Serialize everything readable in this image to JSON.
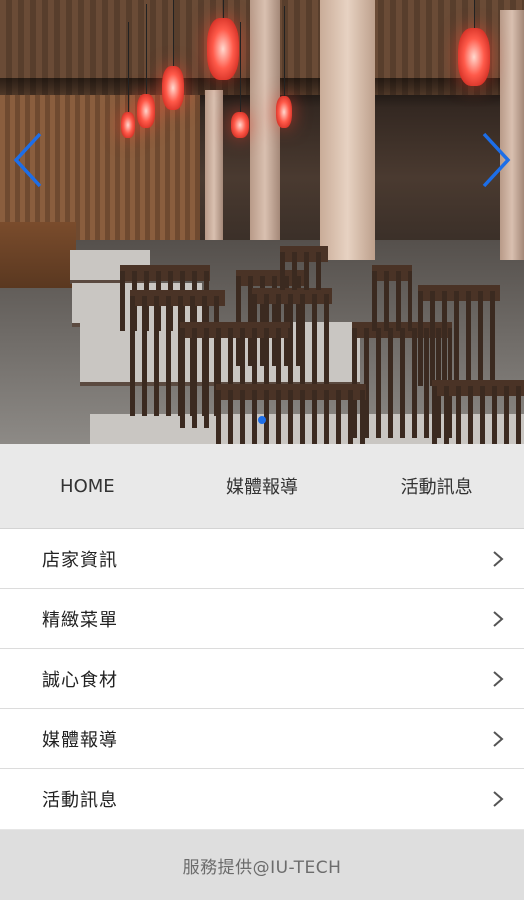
{
  "hero": {
    "slide_count": 1,
    "active_slide": 0,
    "accent_color": "#1d6ee8"
  },
  "tabs": [
    {
      "label": "HOME"
    },
    {
      "label": "媒體報導"
    },
    {
      "label": "活動訊息"
    }
  ],
  "menu": [
    {
      "label": "店家資訊"
    },
    {
      "label": "精緻菜單"
    },
    {
      "label": "誠心食材"
    },
    {
      "label": "媒體報導"
    },
    {
      "label": "活動訊息"
    }
  ],
  "footer": {
    "credit": "服務提供@IU-TECH"
  }
}
